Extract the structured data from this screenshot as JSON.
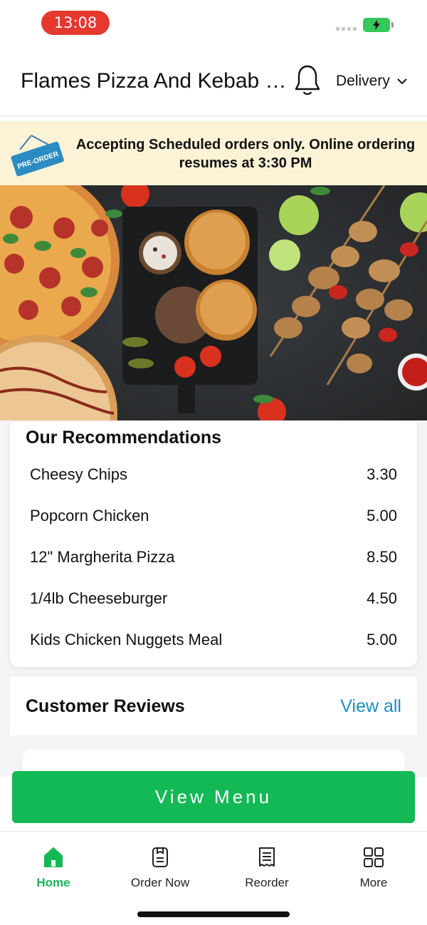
{
  "status_bar": {
    "time": "13:08"
  },
  "header": {
    "title": "Flames Pizza And Kebab House",
    "delivery_label": "Delivery"
  },
  "banner": {
    "sign_text": "PRE-ORDER",
    "message": "Accepting Scheduled orders only. Online ordering resumes at 3:30 PM"
  },
  "recommendations": {
    "title": "Our Recommendations",
    "items": [
      {
        "name": "Cheesy Chips",
        "price": "3.30"
      },
      {
        "name": "Popcorn Chicken",
        "price": "5.00"
      },
      {
        "name": "12\" Margherita Pizza",
        "price": "8.50"
      },
      {
        "name": "1/4lb Cheeseburger",
        "price": "4.50"
      },
      {
        "name": "Kids Chicken Nuggets Meal",
        "price": "5.00"
      }
    ]
  },
  "reviews": {
    "title": "Customer Reviews",
    "view_all": "View all"
  },
  "cta": {
    "label": "View Menu"
  },
  "tabs": [
    {
      "label": "Home",
      "icon": "home-icon",
      "active": true
    },
    {
      "label": "Order Now",
      "icon": "order-icon",
      "active": false
    },
    {
      "label": "Reorder",
      "icon": "receipt-icon",
      "active": false
    },
    {
      "label": "More",
      "icon": "grid-icon",
      "active": false
    }
  ],
  "colors": {
    "accent": "#13b954",
    "link": "#1b8fc4",
    "banner": "#fcf3d6",
    "time_pill": "#e5382f"
  }
}
